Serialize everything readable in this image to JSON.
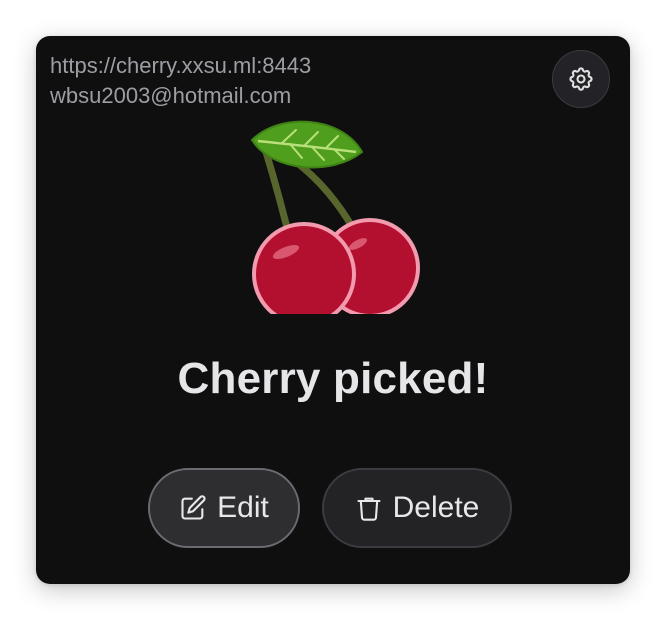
{
  "account": {
    "server_url": "https://cherry.xxsu.ml:8443",
    "email": "wbsu2003@hotmail.com"
  },
  "settings": {
    "icon": "gear-icon"
  },
  "status": {
    "message": "Cherry picked!",
    "illustration": "cherry-illustration"
  },
  "actions": {
    "edit_label": "Edit",
    "edit_icon": "edit-icon",
    "delete_label": "Delete",
    "delete_icon": "trash-icon"
  },
  "colors": {
    "card_background": "#0f0f10",
    "text_muted": "#9d9da3",
    "text_primary": "#e6e6e8",
    "cherry_red": "#b3102f",
    "cherry_outline": "#f29aae",
    "leaf_green": "#4f9e1d"
  }
}
